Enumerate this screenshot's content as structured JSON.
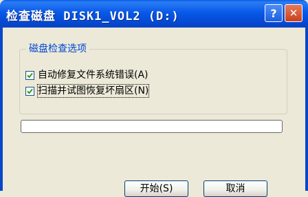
{
  "window": {
    "title": "检查磁盘 DISK1_VOL2 (D:)",
    "help_label": "?",
    "close_label": "✕"
  },
  "options_group": {
    "legend": "磁盘检查选项",
    "options": [
      {
        "label": "自动修复文件系统错误(A)",
        "checked": true
      },
      {
        "label": "扫描并试图恢复坏扇区(N)",
        "checked": true
      }
    ]
  },
  "progress": {
    "value": 0
  },
  "buttons": {
    "start": "开始(S)",
    "cancel": "取消"
  },
  "colors": {
    "titlebar": "#0859e8",
    "legend_text": "#0046d5",
    "face": "#ece9d8",
    "check": "#21a121"
  }
}
